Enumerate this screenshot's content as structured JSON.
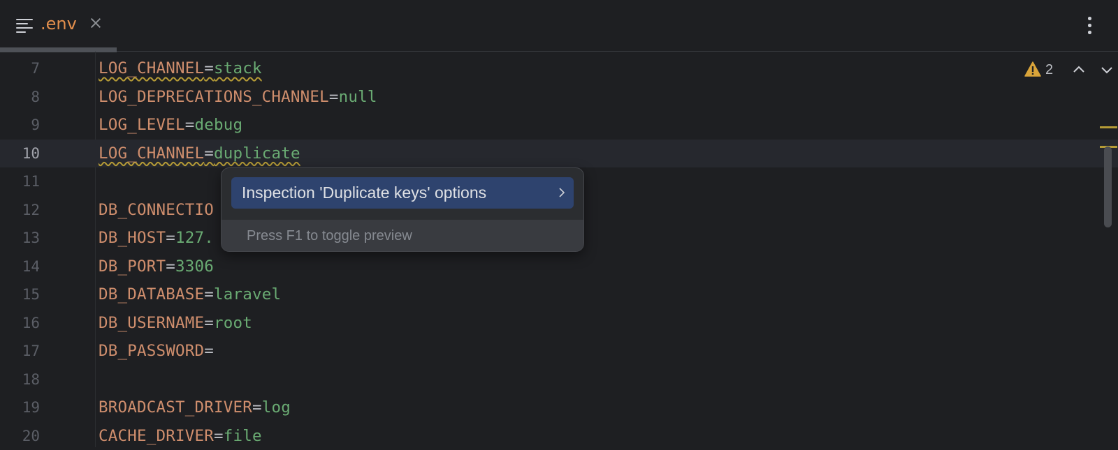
{
  "tab": {
    "title": ".env",
    "file_icon": "text-file-icon",
    "close_icon": "close-icon"
  },
  "toolbar": {
    "more_icon": "more-vertical-icon"
  },
  "inspections": {
    "warning_icon": "warning-icon",
    "warning_count": "2",
    "prev_icon": "chevron-up-icon",
    "next_icon": "chevron-down-icon"
  },
  "editor": {
    "current_line": "10",
    "lines": [
      {
        "num": "7",
        "key": "LOG_CHANNEL",
        "eq": "=",
        "value": "stack"
      },
      {
        "num": "8",
        "key": "LOG_DEPRECATIONS_CHANNEL",
        "eq": "=",
        "value": "null"
      },
      {
        "num": "9",
        "key": "LOG_LEVEL",
        "eq": "=",
        "value": "debug"
      },
      {
        "num": "10",
        "key": "LOG_CHANNEL",
        "eq": "=",
        "value": "duplicate"
      },
      {
        "num": "11",
        "key": "",
        "eq": "",
        "value": ""
      },
      {
        "num": "12",
        "key": "DB_CONNECTIO",
        "eq": "",
        "value": ""
      },
      {
        "num": "13",
        "key": "DB_HOST",
        "eq": "=",
        "value": "127."
      },
      {
        "num": "14",
        "key": "DB_PORT",
        "eq": "=",
        "value": "3306"
      },
      {
        "num": "15",
        "key": "DB_DATABASE",
        "eq": "=",
        "value": "laravel"
      },
      {
        "num": "16",
        "key": "DB_USERNAME",
        "eq": "=",
        "value": "root"
      },
      {
        "num": "17",
        "key": "DB_PASSWORD",
        "eq": "=",
        "value": ""
      },
      {
        "num": "18",
        "key": "",
        "eq": "",
        "value": ""
      },
      {
        "num": "19",
        "key": "BROADCAST_DRIVER",
        "eq": "=",
        "value": "log"
      },
      {
        "num": "20",
        "key": "CACHE_DRIVER",
        "eq": "=",
        "value": "file"
      }
    ]
  },
  "popup": {
    "item_label": "Inspection 'Duplicate keys' options",
    "item_icon": "chevron-right-icon",
    "footer": "Press F1 to toggle preview"
  },
  "colors": {
    "background": "#1e1f22",
    "key": "#cf8e6d",
    "value": "#6aab73",
    "warning": "#b59b36",
    "selection": "#2e436e"
  }
}
